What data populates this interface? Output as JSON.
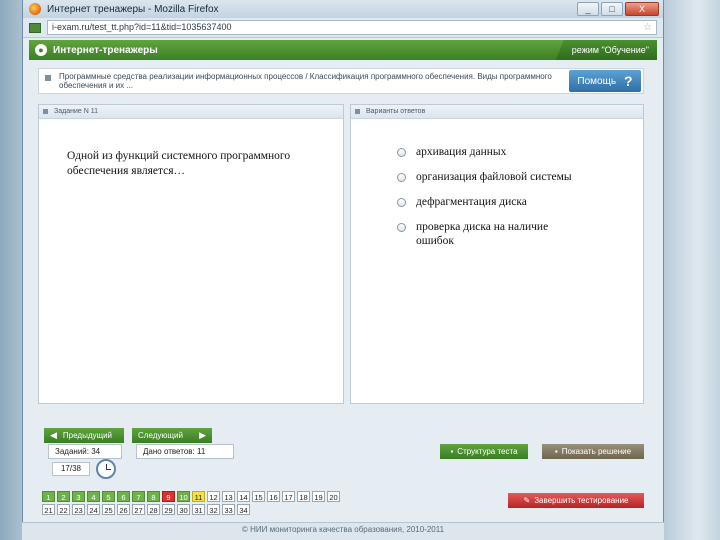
{
  "browser": {
    "title": "Интернет тренажеры - Mozilla Firefox",
    "url": "i-exam.ru/test_tt.php?id=11&tid=1035637400",
    "controls": {
      "minimize": "_",
      "maximize": "□",
      "close": "X"
    }
  },
  "app": {
    "name": "Интернет-тренажеры",
    "mode": "режим \"Обучение\""
  },
  "breadcrumb": {
    "text": "Программные средства реализации информационных процессов / Классификация программного обеспечения. Виды программного обеспечения и их ...",
    "help_label": "Помощь",
    "help_glyph": "?"
  },
  "task": {
    "header": "Задание N 11",
    "question": "Одной из функций системного программного обеспечения является…"
  },
  "answers_panel": {
    "header": "Варианты ответов",
    "options": [
      "архивация данных",
      "организация файловой системы",
      "дефрагментация диска",
      "проверка диска на наличие ошибок"
    ]
  },
  "navigation": {
    "prev_label": "Предыдущий",
    "next_label": "Следующий",
    "total_tasks": "Заданий: 34",
    "answers_given": "Дано ответов: 11",
    "progress": "17/38",
    "structure_label": "Структура теста",
    "show_solution_label": "Показать решение",
    "finish_label": "Завершить тестирование"
  },
  "task_grid": {
    "row1": [
      "1",
      "2",
      "3",
      "4",
      "5",
      "6",
      "7",
      "8",
      "9",
      "10",
      "11",
      "12",
      "13",
      "14",
      "15",
      "16",
      "17",
      "18",
      "19",
      "20"
    ],
    "row2": [
      "21",
      "22",
      "23",
      "24",
      "25",
      "26",
      "27",
      "28",
      "29",
      "30",
      "31",
      "32",
      "33",
      "34"
    ]
  },
  "footer": {
    "copyright": "© НИИ мониторинга качества образования, 2010-2011"
  }
}
